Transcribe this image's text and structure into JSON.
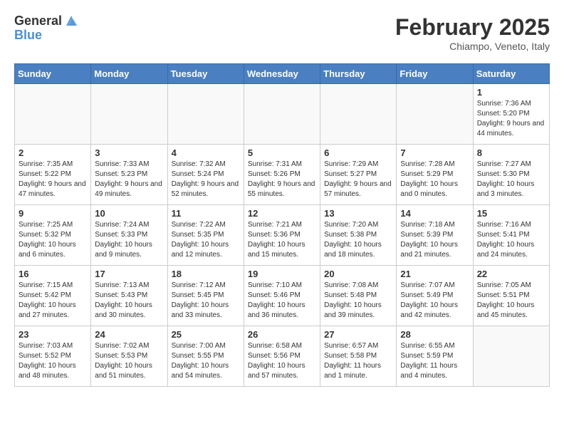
{
  "logo": {
    "general": "General",
    "blue": "Blue"
  },
  "header": {
    "month": "February 2025",
    "location": "Chiampo, Veneto, Italy"
  },
  "weekdays": [
    "Sunday",
    "Monday",
    "Tuesday",
    "Wednesday",
    "Thursday",
    "Friday",
    "Saturday"
  ],
  "weeks": [
    [
      {
        "day": "",
        "info": ""
      },
      {
        "day": "",
        "info": ""
      },
      {
        "day": "",
        "info": ""
      },
      {
        "day": "",
        "info": ""
      },
      {
        "day": "",
        "info": ""
      },
      {
        "day": "",
        "info": ""
      },
      {
        "day": "1",
        "info": "Sunrise: 7:36 AM\nSunset: 5:20 PM\nDaylight: 9 hours and 44 minutes."
      }
    ],
    [
      {
        "day": "2",
        "info": "Sunrise: 7:35 AM\nSunset: 5:22 PM\nDaylight: 9 hours and 47 minutes."
      },
      {
        "day": "3",
        "info": "Sunrise: 7:33 AM\nSunset: 5:23 PM\nDaylight: 9 hours and 49 minutes."
      },
      {
        "day": "4",
        "info": "Sunrise: 7:32 AM\nSunset: 5:24 PM\nDaylight: 9 hours and 52 minutes."
      },
      {
        "day": "5",
        "info": "Sunrise: 7:31 AM\nSunset: 5:26 PM\nDaylight: 9 hours and 55 minutes."
      },
      {
        "day": "6",
        "info": "Sunrise: 7:29 AM\nSunset: 5:27 PM\nDaylight: 9 hours and 57 minutes."
      },
      {
        "day": "7",
        "info": "Sunrise: 7:28 AM\nSunset: 5:29 PM\nDaylight: 10 hours and 0 minutes."
      },
      {
        "day": "8",
        "info": "Sunrise: 7:27 AM\nSunset: 5:30 PM\nDaylight: 10 hours and 3 minutes."
      }
    ],
    [
      {
        "day": "9",
        "info": "Sunrise: 7:25 AM\nSunset: 5:32 PM\nDaylight: 10 hours and 6 minutes."
      },
      {
        "day": "10",
        "info": "Sunrise: 7:24 AM\nSunset: 5:33 PM\nDaylight: 10 hours and 9 minutes."
      },
      {
        "day": "11",
        "info": "Sunrise: 7:22 AM\nSunset: 5:35 PM\nDaylight: 10 hours and 12 minutes."
      },
      {
        "day": "12",
        "info": "Sunrise: 7:21 AM\nSunset: 5:36 PM\nDaylight: 10 hours and 15 minutes."
      },
      {
        "day": "13",
        "info": "Sunrise: 7:20 AM\nSunset: 5:38 PM\nDaylight: 10 hours and 18 minutes."
      },
      {
        "day": "14",
        "info": "Sunrise: 7:18 AM\nSunset: 5:39 PM\nDaylight: 10 hours and 21 minutes."
      },
      {
        "day": "15",
        "info": "Sunrise: 7:16 AM\nSunset: 5:41 PM\nDaylight: 10 hours and 24 minutes."
      }
    ],
    [
      {
        "day": "16",
        "info": "Sunrise: 7:15 AM\nSunset: 5:42 PM\nDaylight: 10 hours and 27 minutes."
      },
      {
        "day": "17",
        "info": "Sunrise: 7:13 AM\nSunset: 5:43 PM\nDaylight: 10 hours and 30 minutes."
      },
      {
        "day": "18",
        "info": "Sunrise: 7:12 AM\nSunset: 5:45 PM\nDaylight: 10 hours and 33 minutes."
      },
      {
        "day": "19",
        "info": "Sunrise: 7:10 AM\nSunset: 5:46 PM\nDaylight: 10 hours and 36 minutes."
      },
      {
        "day": "20",
        "info": "Sunrise: 7:08 AM\nSunset: 5:48 PM\nDaylight: 10 hours and 39 minutes."
      },
      {
        "day": "21",
        "info": "Sunrise: 7:07 AM\nSunset: 5:49 PM\nDaylight: 10 hours and 42 minutes."
      },
      {
        "day": "22",
        "info": "Sunrise: 7:05 AM\nSunset: 5:51 PM\nDaylight: 10 hours and 45 minutes."
      }
    ],
    [
      {
        "day": "23",
        "info": "Sunrise: 7:03 AM\nSunset: 5:52 PM\nDaylight: 10 hours and 48 minutes."
      },
      {
        "day": "24",
        "info": "Sunrise: 7:02 AM\nSunset: 5:53 PM\nDaylight: 10 hours and 51 minutes."
      },
      {
        "day": "25",
        "info": "Sunrise: 7:00 AM\nSunset: 5:55 PM\nDaylight: 10 hours and 54 minutes."
      },
      {
        "day": "26",
        "info": "Sunrise: 6:58 AM\nSunset: 5:56 PM\nDaylight: 10 hours and 57 minutes."
      },
      {
        "day": "27",
        "info": "Sunrise: 6:57 AM\nSunset: 5:58 PM\nDaylight: 11 hours and 1 minute."
      },
      {
        "day": "28",
        "info": "Sunrise: 6:55 AM\nSunset: 5:59 PM\nDaylight: 11 hours and 4 minutes."
      },
      {
        "day": "",
        "info": ""
      }
    ]
  ]
}
